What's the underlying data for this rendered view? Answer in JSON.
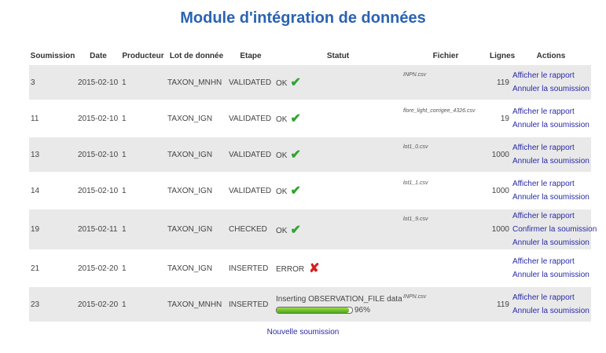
{
  "page": {
    "title": "Module d'intégration de données",
    "new_submission": "Nouvelle soumission"
  },
  "table": {
    "headers": [
      "Soumission",
      "Date",
      "Producteur",
      "Lot de donnée",
      "Etape",
      "Statut",
      "Fichier",
      "Lignes",
      "Actions"
    ],
    "rows": [
      {
        "id": "3",
        "date": "2015-02-10",
        "producer": "1",
        "lot": "TAXON_MNHN",
        "step": "VALIDATED",
        "status": "OK",
        "status_icon": "check-icon",
        "file": "INPN.csv",
        "lines": "119",
        "actions": [
          "Afficher le rapport",
          "Annuler la soumission"
        ]
      },
      {
        "id": "11",
        "date": "2015-02-10",
        "producer": "1",
        "lot": "TAXON_IGN",
        "step": "VALIDATED",
        "status": "OK",
        "status_icon": "check-icon",
        "file": "flore_light_corrigee_4326.csv",
        "lines": "19",
        "actions": [
          "Afficher le rapport",
          "Annuler la soumission"
        ]
      },
      {
        "id": "13",
        "date": "2015-02-10",
        "producer": "1",
        "lot": "TAXON_IGN",
        "step": "VALIDATED",
        "status": "OK",
        "status_icon": "check-icon",
        "file": "lot1_0.csv",
        "lines": "1000",
        "actions": [
          "Afficher le rapport",
          "Annuler la soumission"
        ]
      },
      {
        "id": "14",
        "date": "2015-02-10",
        "producer": "1",
        "lot": "TAXON_IGN",
        "step": "VALIDATED",
        "status": "OK",
        "status_icon": "check-icon",
        "file": "lot1_1.csv",
        "lines": "1000",
        "actions": [
          "Afficher le rapport",
          "Annuler la soumission"
        ]
      },
      {
        "id": "19",
        "date": "2015-02-11",
        "producer": "1",
        "lot": "TAXON_IGN",
        "step": "CHECKED",
        "status": "OK",
        "status_icon": "check-icon",
        "file": "lot1_9.csv",
        "lines": "1000",
        "actions": [
          "Afficher le rapport",
          "Confirmer la soumission",
          "Annuler la soumission"
        ]
      },
      {
        "id": "21",
        "date": "2015-02-20",
        "producer": "1",
        "lot": "TAXON_IGN",
        "step": "INSERTED",
        "status": "ERROR",
        "status_icon": "cross-icon",
        "file": "",
        "lines": "",
        "actions": [
          "Afficher le rapport",
          "Annuler la soumission"
        ]
      },
      {
        "id": "23",
        "date": "2015-02-20",
        "producer": "1",
        "lot": "TAXON_MNHN",
        "step": "INSERTED",
        "status": "Inserting OBSERVATION_FILE data",
        "status_icon": "progress",
        "progress": 0.96,
        "progress_label": "96%",
        "file": "INPN.csv",
        "lines": "119",
        "actions": [
          "Afficher le rapport",
          "Annuler la soumission"
        ]
      }
    ]
  },
  "colors": {
    "title": "#2a63b3",
    "link": "#2a2aaa",
    "ok": "#2fa52f",
    "error": "#d42020",
    "row_shade": "#e9e9e9",
    "progress": "#6cc22a"
  }
}
